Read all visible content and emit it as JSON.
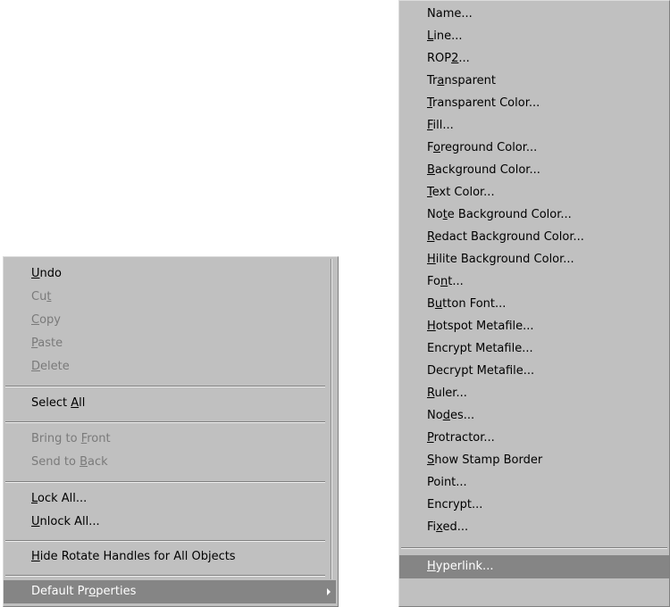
{
  "left_menu": {
    "items": [
      {
        "pre": "",
        "acc": "U",
        "post": "ndo",
        "disabled": false
      },
      {
        "pre": "Cu",
        "acc": "t",
        "post": "",
        "disabled": true
      },
      {
        "pre": "",
        "acc": "C",
        "post": "opy",
        "disabled": true
      },
      {
        "pre": "",
        "acc": "P",
        "post": "aste",
        "disabled": true
      },
      {
        "pre": "",
        "acc": "D",
        "post": "elete",
        "disabled": true
      },
      {
        "pre": "Select ",
        "acc": "A",
        "post": "ll",
        "disabled": false
      },
      {
        "pre": "Bring to ",
        "acc": "F",
        "post": "ront",
        "disabled": true
      },
      {
        "pre": "Send to ",
        "acc": "B",
        "post": "ack",
        "disabled": true
      },
      {
        "pre": "",
        "acc": "L",
        "post": "ock All...",
        "disabled": false
      },
      {
        "pre": "",
        "acc": "U",
        "post": "nlock All...",
        "disabled": false
      },
      {
        "pre": "",
        "acc": "H",
        "post": "ide Rotate Handles for All Objects",
        "disabled": false
      },
      {
        "pre": "Default Pr",
        "acc": "o",
        "post": "perties",
        "disabled": false,
        "highlighted": true
      }
    ]
  },
  "right_menu": {
    "items": [
      {
        "pre": "Name...",
        "acc": "",
        "post": ""
      },
      {
        "pre": "",
        "acc": "L",
        "post": "ine..."
      },
      {
        "pre": "ROP",
        "acc": "2",
        "post": "..."
      },
      {
        "pre": "Tr",
        "acc": "a",
        "post": "nsparent"
      },
      {
        "pre": "",
        "acc": "T",
        "post": "ransparent Color..."
      },
      {
        "pre": "",
        "acc": "F",
        "post": "ill..."
      },
      {
        "pre": "F",
        "acc": "o",
        "post": "reground Color..."
      },
      {
        "pre": "",
        "acc": "B",
        "post": "ackground Color..."
      },
      {
        "pre": "",
        "acc": "T",
        "post": "ext Color..."
      },
      {
        "pre": "No",
        "acc": "t",
        "post": "e Background Color..."
      },
      {
        "pre": "",
        "acc": "R",
        "post": "edact Background Color..."
      },
      {
        "pre": "",
        "acc": "H",
        "post": "ilite Background Color..."
      },
      {
        "pre": "Fo",
        "acc": "n",
        "post": "t..."
      },
      {
        "pre": "B",
        "acc": "u",
        "post": "tton Font..."
      },
      {
        "pre": "",
        "acc": "H",
        "post": "otspot Metafile..."
      },
      {
        "pre": "Encrypt Metafile...",
        "acc": "",
        "post": ""
      },
      {
        "pre": "Decrypt Metafile...",
        "acc": "",
        "post": ""
      },
      {
        "pre": "",
        "acc": "R",
        "post": "uler..."
      },
      {
        "pre": "No",
        "acc": "d",
        "post": "es..."
      },
      {
        "pre": "",
        "acc": "P",
        "post": "rotractor..."
      },
      {
        "pre": "",
        "acc": "S",
        "post": "how Stamp Border"
      },
      {
        "pre": "Point...",
        "acc": "",
        "post": ""
      },
      {
        "pre": "Encrypt...",
        "acc": "",
        "post": ""
      },
      {
        "pre": "Fi",
        "acc": "x",
        "post": "ed..."
      },
      {
        "pre": "",
        "acc": "H",
        "post": "yperlink...",
        "highlighted": true
      }
    ]
  }
}
